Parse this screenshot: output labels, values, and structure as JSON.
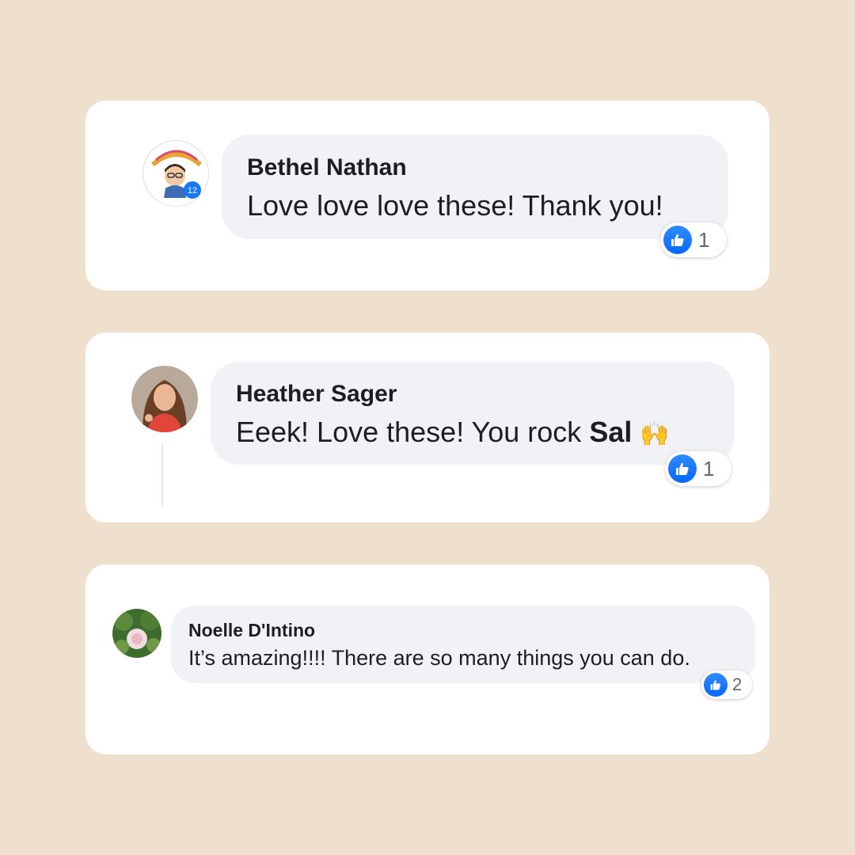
{
  "comments": [
    {
      "author": "Bethel Nathan",
      "text": "Love love love these! Thank you!",
      "reaction": {
        "type": "like-icon",
        "count": "1"
      }
    },
    {
      "author": "Heather Sager",
      "text_prefix": "Eeek! Love these! You rock ",
      "mention": "Sal",
      "emoji": "🙌",
      "reaction": {
        "type": "like-icon",
        "count": "1"
      }
    },
    {
      "author": "Noelle D'Intino",
      "text": "It’s amazing!!!! There are so many things you can do.",
      "reaction": {
        "type": "like-icon",
        "count": "2"
      }
    }
  ],
  "colors": {
    "background": "#EFE0CE",
    "card": "#FFFFFF",
    "bubble": "#F0F2F5",
    "like_blue": "#0866FF"
  }
}
